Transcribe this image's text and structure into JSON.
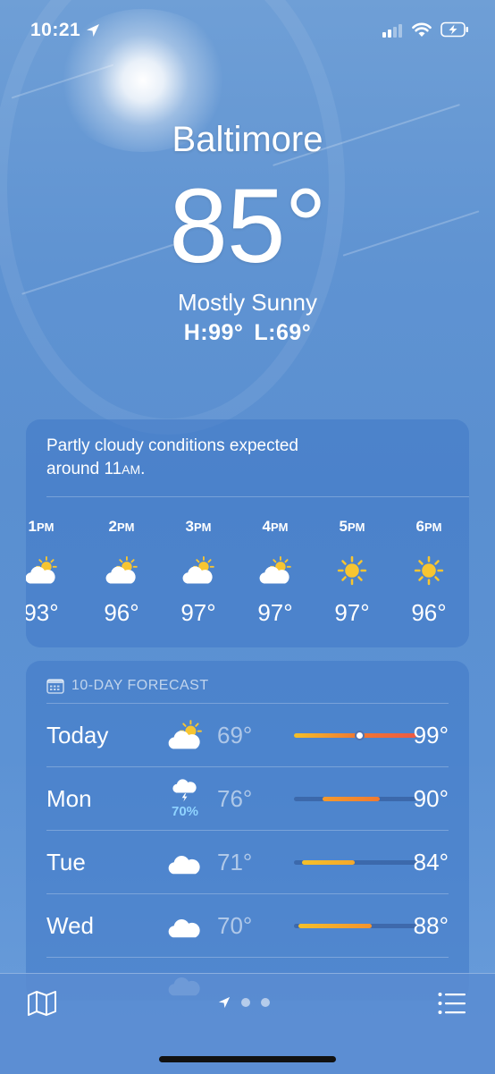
{
  "status_bar": {
    "time": "10:21",
    "icons": [
      "location-arrow-icon",
      "cellular-signal-icon",
      "wifi-icon",
      "battery-charging-icon"
    ]
  },
  "current": {
    "city": "Baltimore",
    "temperature": "85°",
    "condition": "Mostly Sunny",
    "high": "H:99°",
    "low": "L:69°"
  },
  "hourly": {
    "summary_line1": "Partly cloudy conditions expected",
    "summary_line2": "around 11",
    "summary_ampm": "AM",
    "summary_end": ".",
    "items": [
      {
        "time": "1",
        "ampm": "PM",
        "icon": "partly-cloudy-icon",
        "temp": "93°"
      },
      {
        "time": "2",
        "ampm": "PM",
        "icon": "partly-cloudy-icon",
        "temp": "96°"
      },
      {
        "time": "3",
        "ampm": "PM",
        "icon": "partly-cloudy-icon",
        "temp": "97°"
      },
      {
        "time": "4",
        "ampm": "PM",
        "icon": "partly-cloudy-icon",
        "temp": "97°"
      },
      {
        "time": "5",
        "ampm": "PM",
        "icon": "sun-icon",
        "temp": "97°"
      },
      {
        "time": "6",
        "ampm": "PM",
        "icon": "sun-icon",
        "temp": "96°"
      }
    ]
  },
  "daily": {
    "header": "10-DAY FORECAST",
    "header_icon": "calendar-icon",
    "range_min": 69,
    "range_max": 99,
    "rows": [
      {
        "day": "Today",
        "icon": "partly-cloudy-icon",
        "precip": "",
        "low": "69°",
        "high": "99°",
        "low_value": 69,
        "high_value": 99,
        "current_value": 85,
        "colors": [
          "#f3c02a",
          "#f07a30",
          "#ec5a44"
        ]
      },
      {
        "day": "Mon",
        "icon": "thunderstorm-icon",
        "precip": "70%",
        "low": "76°",
        "high": "90°",
        "low_value": 76,
        "high_value": 90,
        "colors": [
          "#f59a2c",
          "#f07a30"
        ]
      },
      {
        "day": "Tue",
        "icon": "cloud-icon",
        "precip": "",
        "low": "71°",
        "high": "84°",
        "low_value": 71,
        "high_value": 84,
        "colors": [
          "#f5c02a",
          "#f4a82c"
        ]
      },
      {
        "day": "Wed",
        "icon": "cloud-icon",
        "precip": "",
        "low": "70°",
        "high": "88°",
        "low_value": 70,
        "high_value": 88,
        "colors": [
          "#f5c02a",
          "#f4932e"
        ]
      }
    ]
  },
  "bottom_bar": {
    "icons": [
      "map-icon",
      "location-arrow-icon",
      "list-icon"
    ],
    "page_count": 3,
    "current_page": 1
  }
}
